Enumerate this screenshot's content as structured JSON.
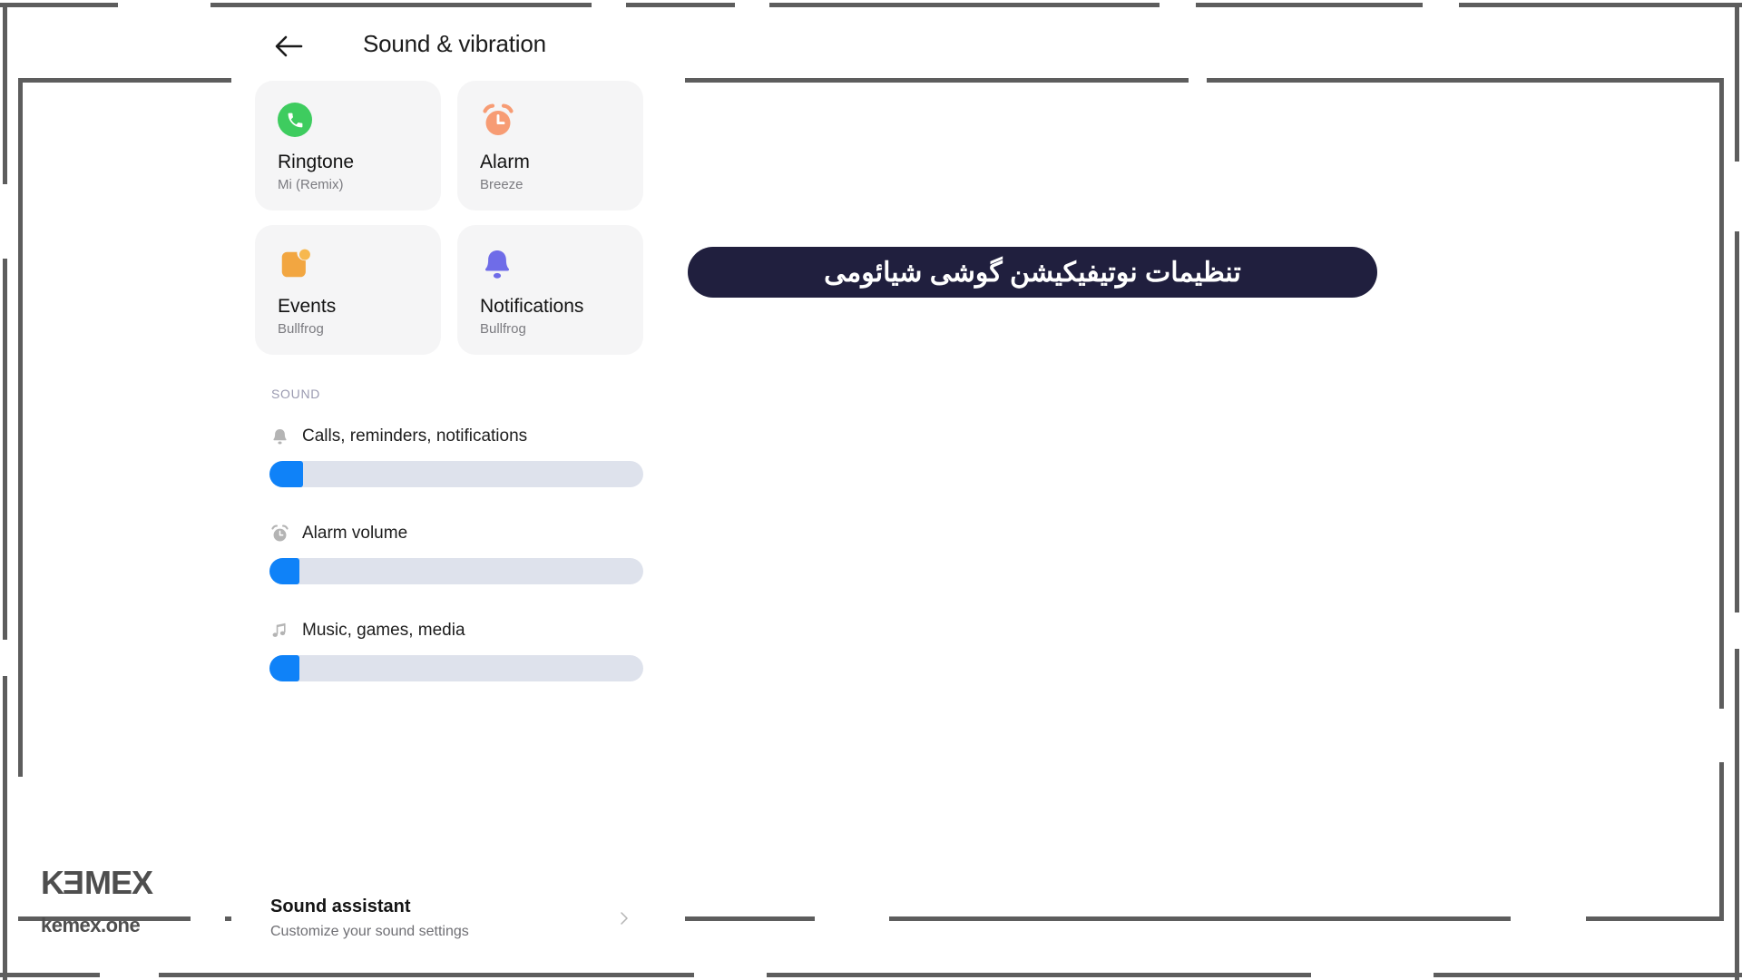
{
  "colors": {
    "accent_blue": "#0f82f8",
    "track_gray": "#dee2ec",
    "tile_bg": "#f5f5f6",
    "ringtone_green": "#3ecc5f",
    "alarm_orange": "#f79c74",
    "events_orange": "#f2a641",
    "bell_purple": "#6f6ce8",
    "banner_navy": "#201f3e",
    "frame_gray": "#5d5d5d",
    "section_label": "#9a9ab0"
  },
  "appbar": {
    "back_icon": "arrow-left-icon",
    "title": "Sound & vibration"
  },
  "tiles": [
    {
      "icon": "phone-icon",
      "name": "Ringtone",
      "sub": "Mi (Remix)"
    },
    {
      "icon": "alarm-clock-icon",
      "name": "Alarm",
      "sub": "Breeze"
    },
    {
      "icon": "events-badge-icon",
      "name": "Events",
      "sub": "Bullfrog"
    },
    {
      "icon": "bell-icon",
      "name": "Notifications",
      "sub": "Bullfrog"
    }
  ],
  "sound_section": {
    "label": "SOUND",
    "sliders": [
      {
        "icon": "bell-outline-icon",
        "label": "Calls, reminders, notifications",
        "value_percent": 9
      },
      {
        "icon": "alarm-outline-icon",
        "label": "Alarm volume",
        "value_percent": 8
      },
      {
        "icon": "music-note-icon",
        "label": "Music, games, media",
        "value_percent": 8
      }
    ]
  },
  "assistant": {
    "title": "Sound assistant",
    "subtitle": "Customize your sound settings",
    "chevron_icon": "chevron-right-icon"
  },
  "banner": {
    "text": "تنظیمات نوتیفیکیشن گوشی شیائومی"
  },
  "logo": {
    "mark_part1": "K",
    "mark_part2": "E",
    "mark_part3": "MEX",
    "url": "kemex.one"
  }
}
